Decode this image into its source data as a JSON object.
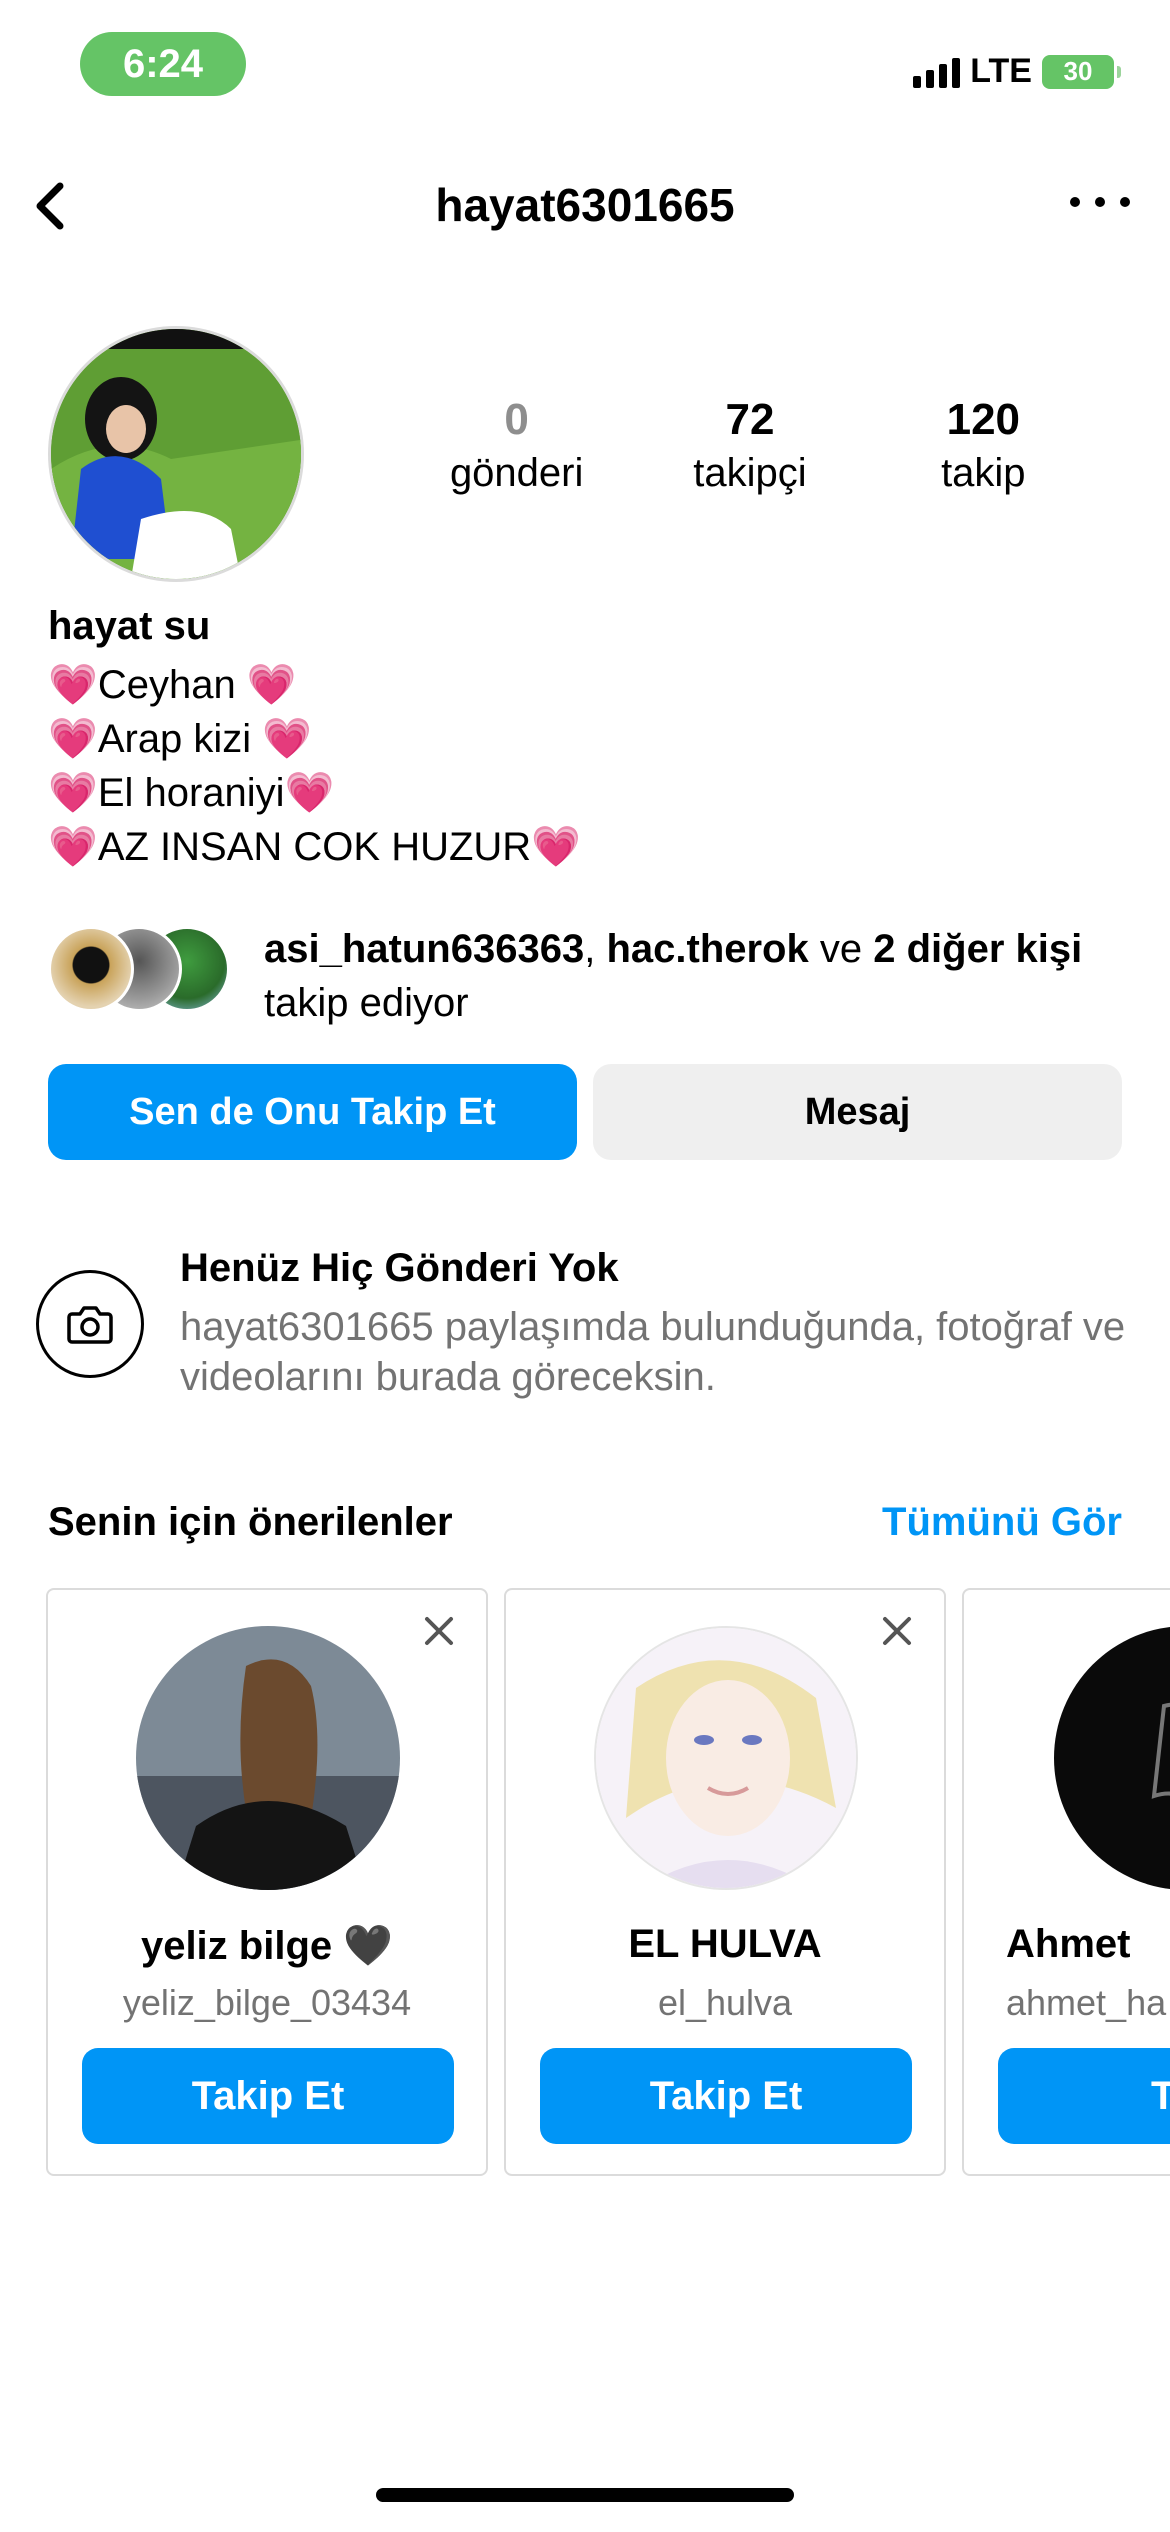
{
  "status_bar": {
    "time": "6:24",
    "network": "LTE",
    "battery": "30"
  },
  "header": {
    "username": "hayat6301665"
  },
  "profile": {
    "stats": [
      {
        "value": "0",
        "label": "gönderi"
      },
      {
        "value": "72",
        "label": "takipçi"
      },
      {
        "value": "120",
        "label": "takip"
      }
    ],
    "display_name": "hayat su",
    "bio": [
      "Ceyhan",
      "Arap kizi",
      "El horaniyi",
      "AZ INSAN COK HUZUR"
    ]
  },
  "followed_by": {
    "user1": "asi_hatun636363",
    "separator": ",",
    "user2": "hac.therok",
    "conjunction": "ve",
    "others": "2 diğer kişi",
    "suffix": "takip ediyor"
  },
  "actions": {
    "follow_label": "Sen de Onu Takip Et",
    "message_label": "Mesaj"
  },
  "no_posts": {
    "title": "Henüz Hiç Gönderi Yok",
    "description": "hayat6301665 paylaşımda bulunduğunda, fotoğraf ve videolarını burada göreceksin."
  },
  "suggestions": {
    "title": "Senin için önerilenler",
    "see_all": "Tümünü Gör",
    "cards": [
      {
        "name": "yeliz bilge 🖤",
        "username": "yeliz_bilge_03434",
        "button": "Takip Et"
      },
      {
        "name": "EL HULVA",
        "username": "el_hulva",
        "button": "Takip Et"
      },
      {
        "name": "Ahmet",
        "username": "ahmet_ha",
        "button": "Tak"
      }
    ]
  },
  "colors": {
    "accent": "#0095f6",
    "status_green": "#65c466",
    "heart_pink": "#ff5ab1"
  }
}
